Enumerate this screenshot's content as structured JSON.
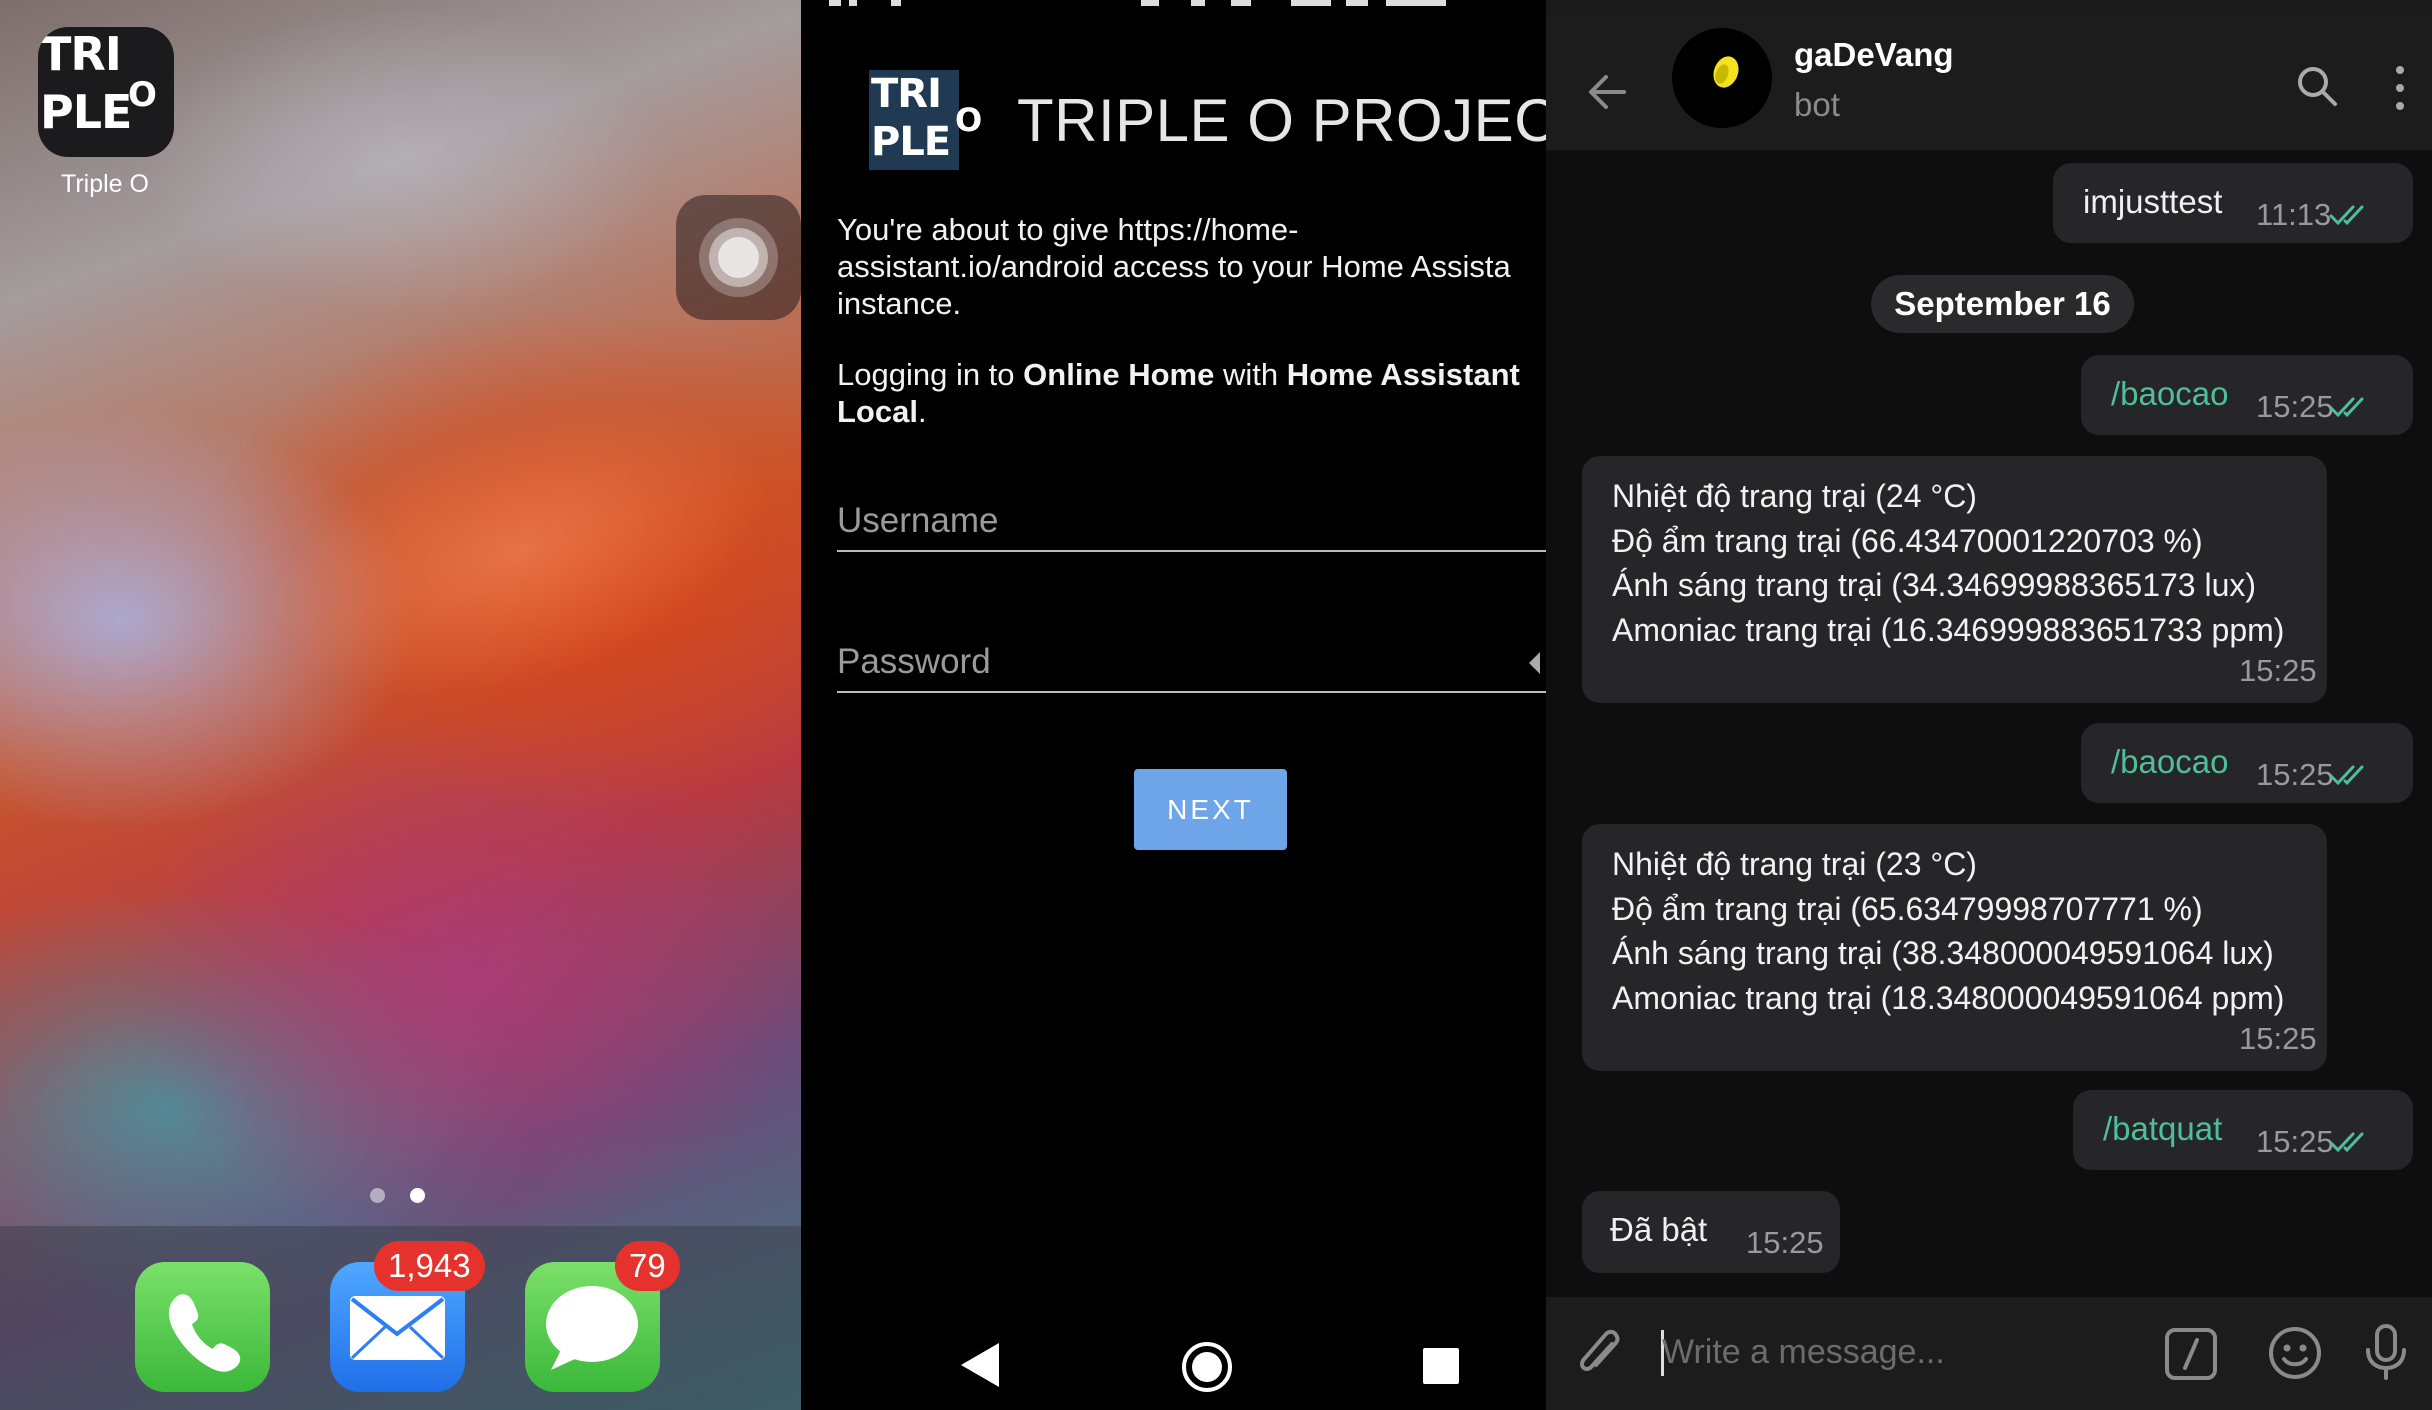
{
  "ios_home": {
    "app_label": "Triple O",
    "logo_lines": [
      "TRI",
      "PLE",
      "O"
    ],
    "dock_badges": {
      "mail": "1,943",
      "messages": "79"
    },
    "page_dots": 2,
    "active_page": 2
  },
  "android_login": {
    "logo_lines": [
      "TRI",
      "PLE",
      "O"
    ],
    "title": "TRIPLE O PROJECT",
    "access_text_1": "You're about to give https://home-",
    "access_text_2": "assistant.io/android access to your Home Assista",
    "access_text_3": "instance.",
    "login_prefix": "Logging in to ",
    "login_home": "Online Home",
    "login_mid": " with ",
    "login_provider_1": "Home Assistant",
    "login_provider_2": "Local",
    "login_suffix": ".",
    "username_placeholder": "Username",
    "password_placeholder": "Password",
    "next_label": "NEXT"
  },
  "telegram": {
    "chat_name": "gaDeVang",
    "chat_subtitle": "bot",
    "date_separator": "September 16",
    "messages": [
      {
        "direction": "out",
        "text": "imjusttest",
        "time": "11:13",
        "read": true
      },
      {
        "direction": "out",
        "text": "/baocao",
        "time": "15:25",
        "read": true
      },
      {
        "direction": "in",
        "lines": [
          "Nhiệt độ trang trại (24 °C)",
          "Độ ẩm trang trại (66.43470001220703 %)",
          "Ánh sáng trang trại (34.34699988365173 lux)",
          "Amoniac trang trại (16.346999883651733 ppm)"
        ],
        "time": "15:25"
      },
      {
        "direction": "out",
        "text": "/baocao",
        "time": "15:25",
        "read": true
      },
      {
        "direction": "in",
        "lines": [
          "Nhiệt độ trang trại (23 °C)",
          "Độ ẩm trang trại (65.63479998707771 %)",
          "Ánh sáng trang trại (38.348000049591064 lux)",
          "Amoniac trang trại (18.348000049591064 ppm)"
        ],
        "time": "15:25"
      },
      {
        "direction": "out",
        "text": "/batquat",
        "time": "15:25",
        "read": true
      },
      {
        "direction": "in",
        "text": "Đã bật",
        "time": "15:25"
      }
    ],
    "input_placeholder": "Write a message..."
  },
  "colors": {
    "next_button": "#6ea4e8",
    "command_text": "#4fbe9a",
    "read_ticks": "#4fbe9a",
    "badge": "#e5322d"
  }
}
